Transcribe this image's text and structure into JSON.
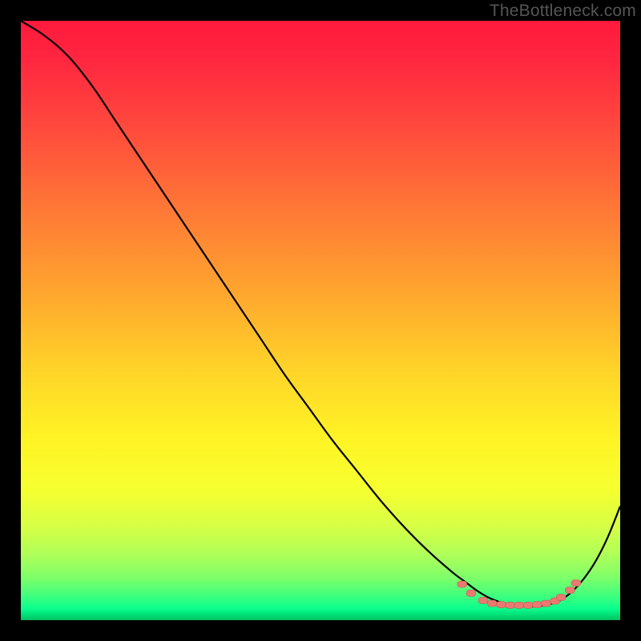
{
  "watermark": "TheBottleneck.com",
  "colors": {
    "frame": "#000000",
    "curve": "#000000",
    "marker_fill": "#e87a72",
    "marker_stroke": "#c55b54"
  },
  "chart_data": {
    "type": "line",
    "title": "",
    "xlabel": "",
    "ylabel": "",
    "xlim": [
      0,
      100
    ],
    "ylim": [
      0,
      100
    ],
    "series": [
      {
        "name": "curve",
        "x": [
          0,
          4,
          8,
          12,
          16,
          20,
          24,
          28,
          32,
          36,
          40,
          44,
          48,
          52,
          56,
          60,
          64,
          68,
          72,
          74,
          76,
          78,
          80,
          82,
          84,
          86,
          88,
          90,
          92,
          94,
          96,
          98,
          100
        ],
        "y": [
          100,
          97.5,
          94,
          89,
          83,
          77,
          71,
          65,
          59,
          53,
          47,
          41,
          35.5,
          30,
          25,
          20,
          15.5,
          11.5,
          8,
          6.5,
          5,
          3.8,
          3,
          2.5,
          2.3,
          2.3,
          2.6,
          3.3,
          4.8,
          7,
          10,
          14,
          19
        ]
      }
    ],
    "markers": {
      "name": "cluster",
      "points": [
        {
          "x": 73.5,
          "y": 6.0
        },
        {
          "x": 75.0,
          "y": 4.5
        },
        {
          "x": 77.0,
          "y": 3.3
        },
        {
          "x": 78.5,
          "y": 2.8
        },
        {
          "x": 80.0,
          "y": 2.6
        },
        {
          "x": 81.5,
          "y": 2.5
        },
        {
          "x": 83.0,
          "y": 2.5
        },
        {
          "x": 84.5,
          "y": 2.5
        },
        {
          "x": 86.0,
          "y": 2.6
        },
        {
          "x": 87.5,
          "y": 2.8
        },
        {
          "x": 89.0,
          "y": 3.2
        },
        {
          "x": 90.0,
          "y": 3.8
        },
        {
          "x": 91.5,
          "y": 5.0
        },
        {
          "x": 92.5,
          "y": 6.2
        }
      ]
    }
  }
}
